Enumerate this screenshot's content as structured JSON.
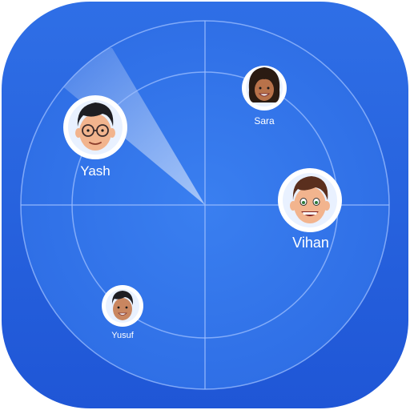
{
  "app": {
    "name": "",
    "theme": {
      "tile_top": "#2f6fe6",
      "tile_bottom": "#1f56d6",
      "radar_line": "#8fb6ff",
      "sweep": "#ffffff",
      "label": "#ffffff"
    }
  },
  "radar": {
    "users": [
      {
        "name": "Sara",
        "avatar_icon": "girl-avatar-icon"
      },
      {
        "name": "Yash",
        "avatar_icon": "boy-glasses-avatar-icon"
      },
      {
        "name": "Vihan",
        "avatar_icon": "boy-smile-avatar-icon"
      },
      {
        "name": "Yusuf",
        "avatar_icon": "boy-avatar-icon"
      }
    ]
  }
}
